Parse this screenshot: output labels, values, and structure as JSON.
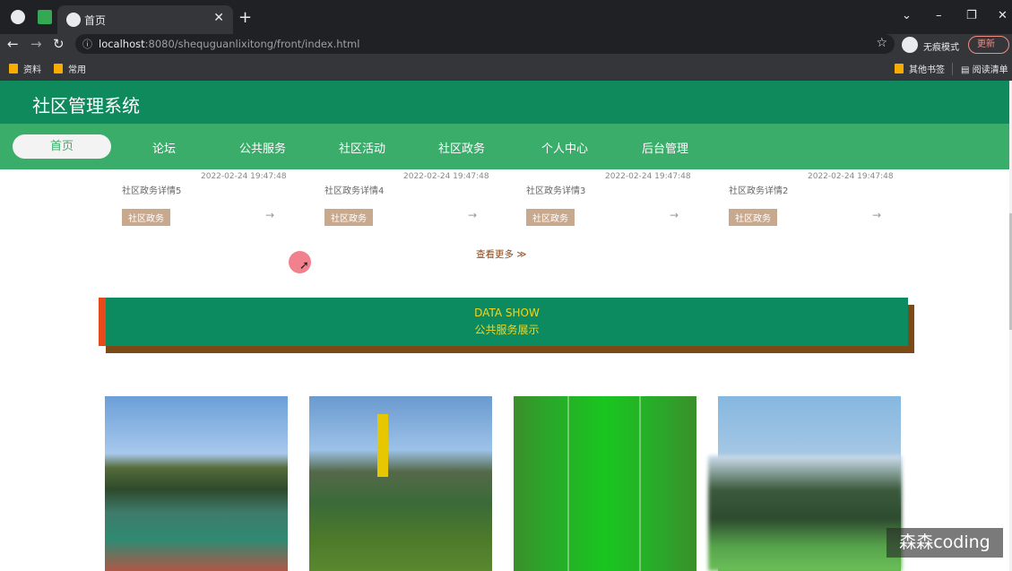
{
  "browser": {
    "tab_title": "首页",
    "url_host": "localhost",
    "url_rest": ":8080/shequguanlixitong/front/index.html",
    "incognito_label": "无痕模式",
    "update_label": "更新",
    "bookmarks": [
      "资料",
      "常用"
    ],
    "bookmarks_right": [
      "其他书签",
      "阅读清单"
    ]
  },
  "site": {
    "title": "社区管理系统",
    "nav": [
      "首页",
      "论坛",
      "公共服务",
      "社区活动",
      "社区政务",
      "个人中心",
      "后台管理"
    ]
  },
  "news": [
    {
      "title": "社区政务详情5",
      "date": "2022-02-24 19:47:48",
      "tag": "社区政务"
    },
    {
      "title": "社区政务详情4",
      "date": "2022-02-24 19:47:48",
      "tag": "社区政务"
    },
    {
      "title": "社区政务详情3",
      "date": "2022-02-24 19:47:48",
      "tag": "社区政务"
    },
    {
      "title": "社区政务详情2",
      "date": "2022-02-24 19:47:48",
      "tag": "社区政务"
    }
  ],
  "more_label": "查看更多 ≫",
  "section": {
    "english": "DATA SHOW",
    "chinese": "公共服务展示"
  },
  "watermark": "森森coding"
}
